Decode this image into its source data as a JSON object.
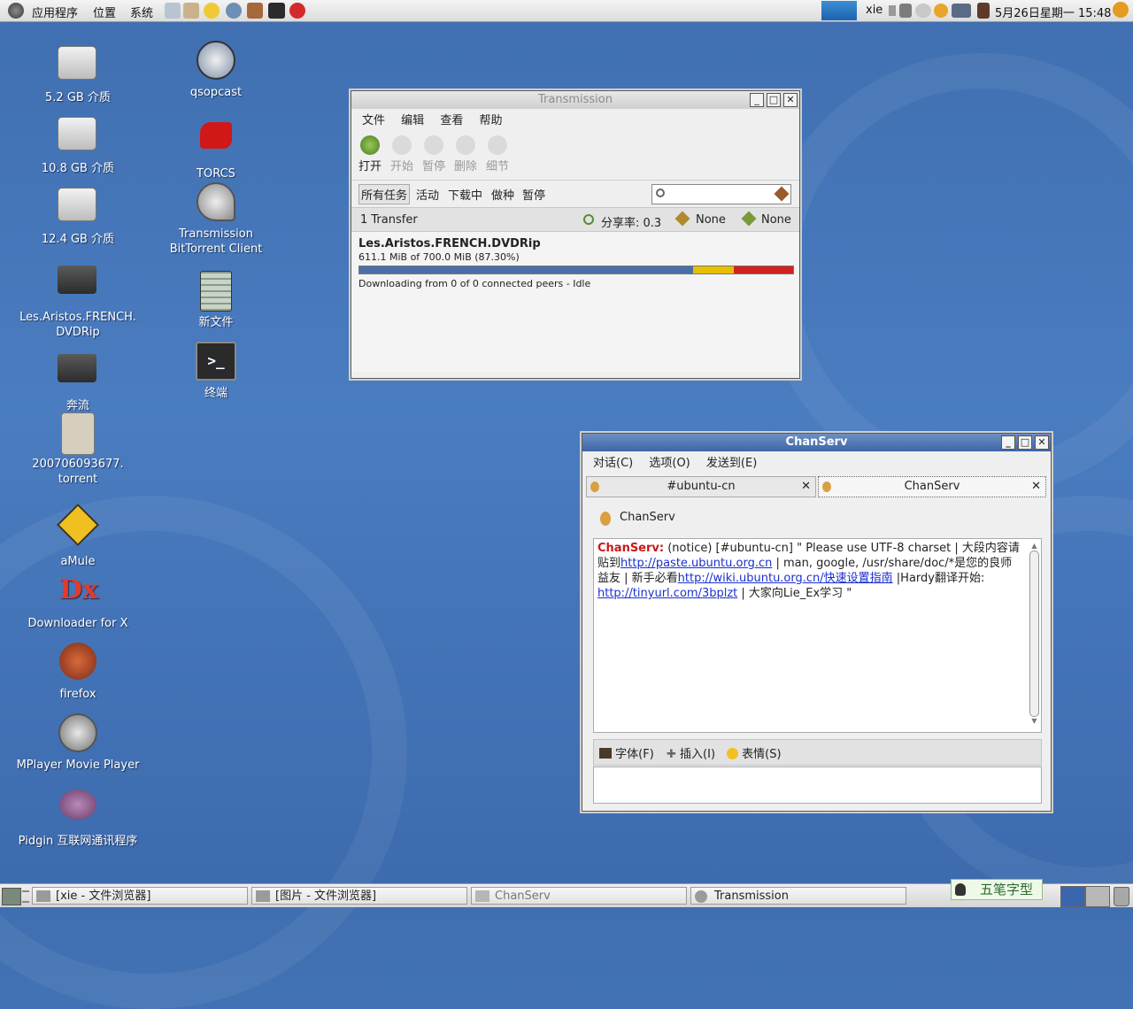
{
  "top_panel": {
    "menus": [
      "应用程序",
      "位置",
      "系统"
    ],
    "user": "xie",
    "clock": "5月26日星期一 15:48"
  },
  "desktop": {
    "icons_left": [
      {
        "label": "5.2 GB 介质",
        "icon": "drive-icon"
      },
      {
        "label": "10.8 GB 介质",
        "icon": "drive-icon"
      },
      {
        "label": "12.4 GB 介质",
        "icon": "drive-icon"
      },
      {
        "label": "Les.Aristos.FRENCH.\nDVDRip",
        "icon": "folder-icon"
      },
      {
        "label": "奔流",
        "icon": "folder-icon"
      },
      {
        "label": "200706093677.\ntorrent",
        "icon": "torrent-file-icon"
      },
      {
        "label": "aMule",
        "icon": "amule-icon"
      },
      {
        "label": "Downloader for X",
        "icon": "d4x-icon"
      },
      {
        "label": "firefox",
        "icon": "firefox-icon"
      },
      {
        "label": "MPlayer Movie Player",
        "icon": "mplayer-icon"
      },
      {
        "label": "Pidgin 互联网通讯程序",
        "icon": "pidgin-icon"
      }
    ],
    "icons_right": [
      {
        "label": "qsopcast",
        "icon": "qsopcast-icon"
      },
      {
        "label": "TORCS",
        "icon": "torcs-icon"
      },
      {
        "label": "Transmission\nBitTorrent Client",
        "icon": "transmission-icon"
      },
      {
        "label": "新文件",
        "icon": "text-file-icon"
      },
      {
        "label": "终端",
        "icon": "terminal-icon"
      }
    ]
  },
  "transmission": {
    "title": "Transmission",
    "menu": [
      "文件",
      "编辑",
      "查看",
      "帮助"
    ],
    "toolbar": [
      "打开",
      "开始",
      "暂停",
      "删除",
      "细节"
    ],
    "filters": [
      "所有任务",
      "活动",
      "下载中",
      "做种",
      "暂停"
    ],
    "status": {
      "transfers": "1 Transfer",
      "ratio": "分享率: 0.3",
      "down": "None",
      "up": "None"
    },
    "torrent": {
      "name": "Les.Aristos.FRENCH.DVDRip",
      "progress_text": "611.1 MiB of 700.0 MiB (87.30%)",
      "progress_fraction": 0.873,
      "status": "Downloading from 0 of 0 connected peers - Idle"
    }
  },
  "chat": {
    "title": "ChanServ",
    "menu": [
      "对话(C)",
      "选项(O)",
      "发送到(E)"
    ],
    "tabs": [
      "#ubuntu-cn",
      "ChanServ"
    ],
    "buddy": "ChanServ",
    "message": {
      "sender": "ChanServ:",
      "t1": " (notice) [#ubuntu-cn] \" Please use UTF-8 charset | 大段内容请贴到",
      "link1": "http://paste.ubuntu.org.cn",
      "t2": " | man, google, /usr/share/doc/*是您的良师益友 | 新手必看",
      "link2": "http://wiki.ubuntu.org.cn/快速设置指南",
      "t3": " |Hardy翻译开始: ",
      "link3": "http://tinyurl.com/3bplzt",
      "t4": " | 大家向Lie_Ex学习 \""
    },
    "format_bar": [
      "字体(F)",
      "插入(I)",
      "表情(S)"
    ]
  },
  "bottom_panel": {
    "tasks": [
      "[xie - 文件浏览器]",
      "[图片 - 文件浏览器]",
      "ChanServ",
      "Transmission"
    ],
    "ime": "五笔字型"
  },
  "colors": {
    "progress_blue": "#4a6fa8",
    "progress_yellow": "#e6c000",
    "progress_red": "#d02020",
    "link": "#1a2fd0"
  }
}
